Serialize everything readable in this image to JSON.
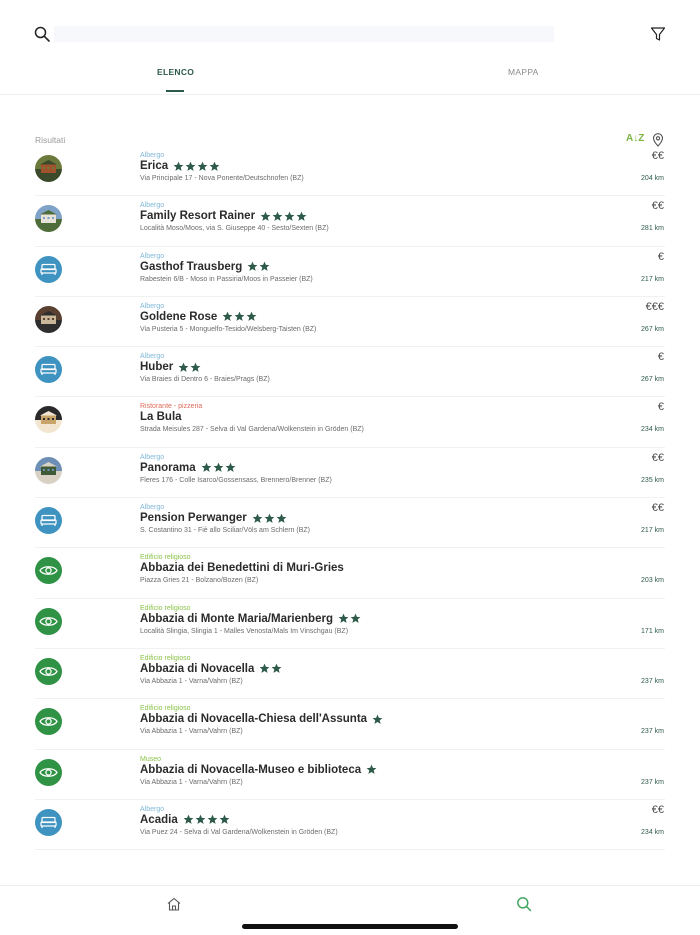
{
  "search": {
    "value": "",
    "placeholder": ""
  },
  "tabs": {
    "list": "ELENCO",
    "map": "MAPPA"
  },
  "results": {
    "label": "Risultati",
    "sort_label": "A↓Z"
  },
  "colors": {
    "accent": "#2d5a49",
    "hotel_category": "#7fb8d8",
    "restaurant_category": "#e06a5a",
    "poi_category": "#8bc34a",
    "star": "#2d5a49",
    "bed_badge": "#3e93c0",
    "eye_badge": "#2f9244"
  },
  "items": [
    {
      "category": "Albergo",
      "category_type": "hotel",
      "name": "Erica",
      "stars": 4,
      "address": "Via Principale 17 - Nova Ponente/Deutschnofen (BZ)",
      "price": "€€",
      "distance": "204 km",
      "thumb": "photo",
      "photo_variant": 0
    },
    {
      "category": "Albergo",
      "category_type": "hotel",
      "name": "Family Resort Rainer",
      "stars": 4,
      "address": "Località Moso/Moos, via S. Giuseppe 40 - Sesto/Sexten (BZ)",
      "price": "€€",
      "distance": "281 km",
      "thumb": "photo",
      "photo_variant": 1
    },
    {
      "category": "Albergo",
      "category_type": "hotel",
      "name": "Gasthof Trausberg",
      "stars": 2,
      "address": "Rabestein 6/B - Moso in Passiria/Moos in Passeier (BZ)",
      "price": "€",
      "distance": "217 km",
      "thumb": "bed"
    },
    {
      "category": "Albergo",
      "category_type": "hotel",
      "name": "Goldene Rose",
      "stars": 3,
      "address": "Via Pusteria 5 - Monguelfo-Tesido/Welsberg-Taisten (BZ)",
      "price": "€€€",
      "distance": "267 km",
      "thumb": "photo",
      "photo_variant": 2
    },
    {
      "category": "Albergo",
      "category_type": "hotel",
      "name": "Huber",
      "stars": 2,
      "address": "Via Braies di Dentro 6 - Braies/Prags (BZ)",
      "price": "€",
      "distance": "267 km",
      "thumb": "bed"
    },
    {
      "category": "Ristorante - pizzeria",
      "category_type": "restaurant",
      "name": "La Bula",
      "stars": 0,
      "address": "Strada Meisules 287 - Selva di Val Gardena/Wolkenstein in Gröden (BZ)",
      "price": "€",
      "distance": "234 km",
      "thumb": "photo",
      "photo_variant": 3
    },
    {
      "category": "Albergo",
      "category_type": "hotel",
      "name": "Panorama",
      "stars": 3,
      "address": "Fleres 176 - Colle Isarco/Gossensass, Brennero/Brenner (BZ)",
      "price": "€€",
      "distance": "235 km",
      "thumb": "photo",
      "photo_variant": 4
    },
    {
      "category": "Albergo",
      "category_type": "hotel",
      "name": "Pension Perwanger",
      "stars": 3,
      "address": "S. Costantino 31 - Fiè allo Sciliar/Völs am Schlern (BZ)",
      "price": "€€",
      "distance": "217 km",
      "thumb": "bed"
    },
    {
      "category": "Edificio religioso",
      "category_type": "poi",
      "name": "Abbazia dei Benedettini di Muri-Gries",
      "stars": 0,
      "address": "Piazza Gries 21 - Bolzano/Bozen (BZ)",
      "price": "",
      "distance": "203 km",
      "thumb": "eye"
    },
    {
      "category": "Edificio religioso",
      "category_type": "poi",
      "name": "Abbazia di Monte Maria/Marienberg",
      "stars": 2,
      "address": "Località Slingia, Slingia 1 - Malles Venosta/Mals Im Vinschgau (BZ)",
      "price": "",
      "distance": "171 km",
      "thumb": "eye"
    },
    {
      "category": "Edificio religioso",
      "category_type": "poi",
      "name": "Abbazia di Novacella",
      "stars": 2,
      "address": "Via Abbazia 1 - Varna/Vahrn (BZ)",
      "price": "",
      "distance": "237 km",
      "thumb": "eye"
    },
    {
      "category": "Edificio religioso",
      "category_type": "poi",
      "name": "Abbazia di Novacella-Chiesa dell'Assunta",
      "stars": 1,
      "address": "Via Abbazia 1 - Varna/Vahrn (BZ)",
      "price": "",
      "distance": "237 km",
      "thumb": "eye"
    },
    {
      "category": "Museo",
      "category_type": "poi",
      "name": "Abbazia di Novacella-Museo e biblioteca",
      "stars": 1,
      "address": "Via Abbazia 1 - Varna/Vahrn (BZ)",
      "price": "",
      "distance": "237 km",
      "thumb": "eye"
    },
    {
      "category": "Albergo",
      "category_type": "hotel",
      "name": "Acadia",
      "stars": 4,
      "address": "Via Puez 24 - Selva di Val Gardena/Wolkenstein in Gröden (BZ)",
      "price": "€€",
      "distance": "234 km",
      "thumb": "bed"
    }
  ],
  "bottom_nav": {
    "home_icon": "home-icon",
    "search_icon": "search-icon"
  }
}
